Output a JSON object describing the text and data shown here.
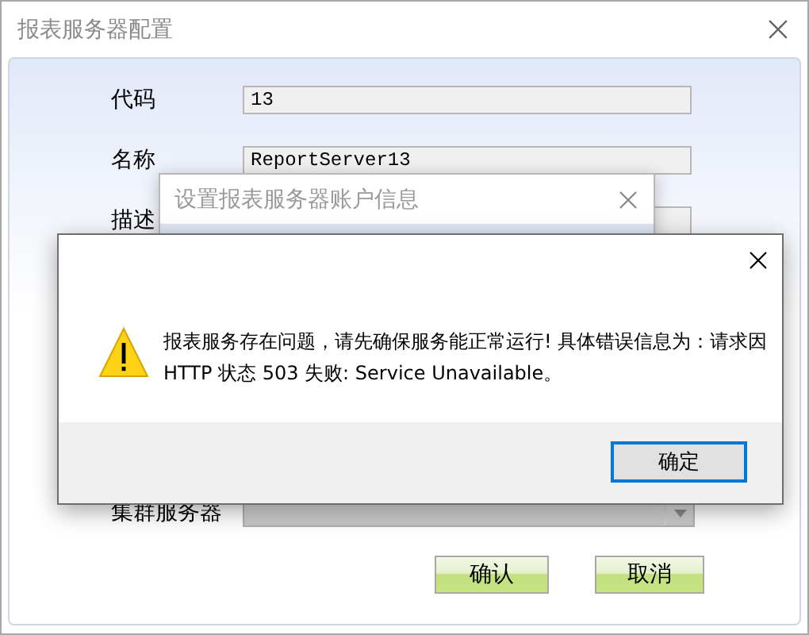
{
  "main_window": {
    "title": "报表服务器配置",
    "fields": [
      {
        "label": "代码",
        "value": "13"
      },
      {
        "label": "名称",
        "value": "ReportServer13"
      },
      {
        "label": "描述"
      }
    ],
    "cluster": {
      "label": "集群服务器",
      "disabled": true
    },
    "buttons": [
      "确认",
      "取消"
    ]
  },
  "account_dialog": {
    "title": "设置报表服务器账户信息"
  },
  "message_box": {
    "message": "报表服务存在问题，请先确保服务能正常运行! 具体错误信息为：请求因HTTP 状态 503 失败: Service Unavailable。",
    "button": "确定"
  }
}
